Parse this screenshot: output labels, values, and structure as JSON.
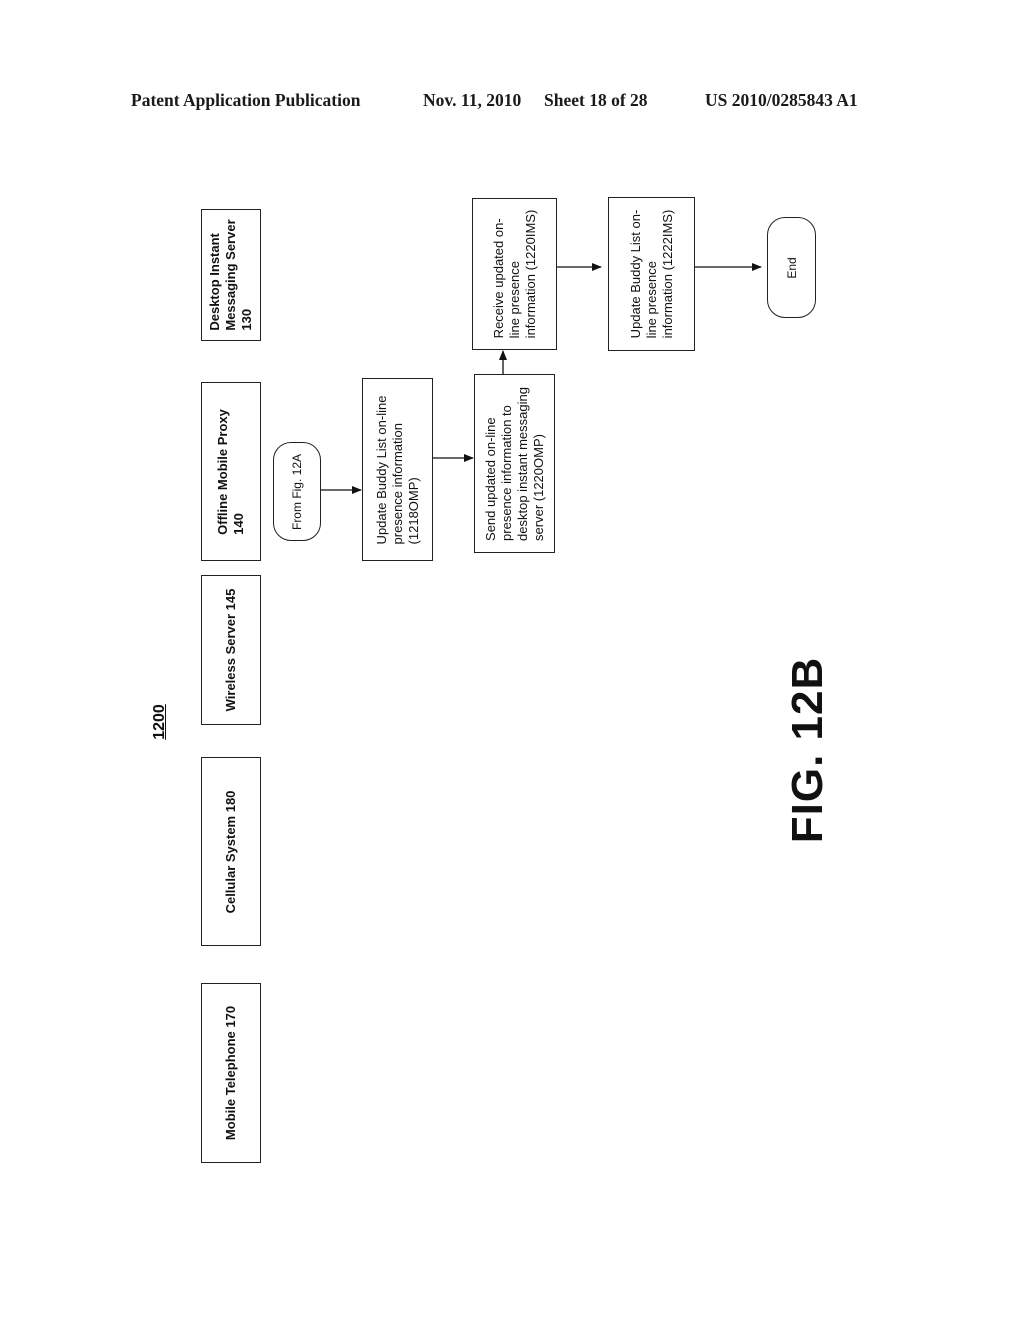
{
  "header": {
    "publication": "Patent Application Publication",
    "date": "Nov. 11, 2010",
    "sheet": "Sheet 18 of 28",
    "patent_number": "US 2010/0285843 A1"
  },
  "figure": {
    "reference_number": "1200",
    "caption": "FIG. 12B"
  },
  "lanes": [
    {
      "line1": "Desktop Instant",
      "line2": "Messaging Server",
      "line3": "130"
    },
    {
      "line1": "Offline Mobile Proxy",
      "line2": "140"
    },
    {
      "line1": "Wireless Server 145"
    },
    {
      "line1": "Cellular System 180"
    },
    {
      "line1": "Mobile Telephone 170"
    }
  ],
  "steps": {
    "from_connector": "From Fig. 12A",
    "update_buddy_omp": {
      "line1": "Update Buddy List on-line",
      "line2": "presence information",
      "line3": "(1218OMP)"
    },
    "send_updated": {
      "line1": "Send updated on-line",
      "line2": "presence information to",
      "line3": "desktop instant messaging",
      "line4": "server (1220OMP)"
    },
    "receive_updated": {
      "line1": "Receive updated on-",
      "line2": "line presence",
      "line3": "information (1220IMS)"
    },
    "update_buddy_ims": {
      "line1": "Update Buddy List on-",
      "line2": "line presence",
      "line3": "information (1222IMS)"
    },
    "end_connector": "End"
  }
}
